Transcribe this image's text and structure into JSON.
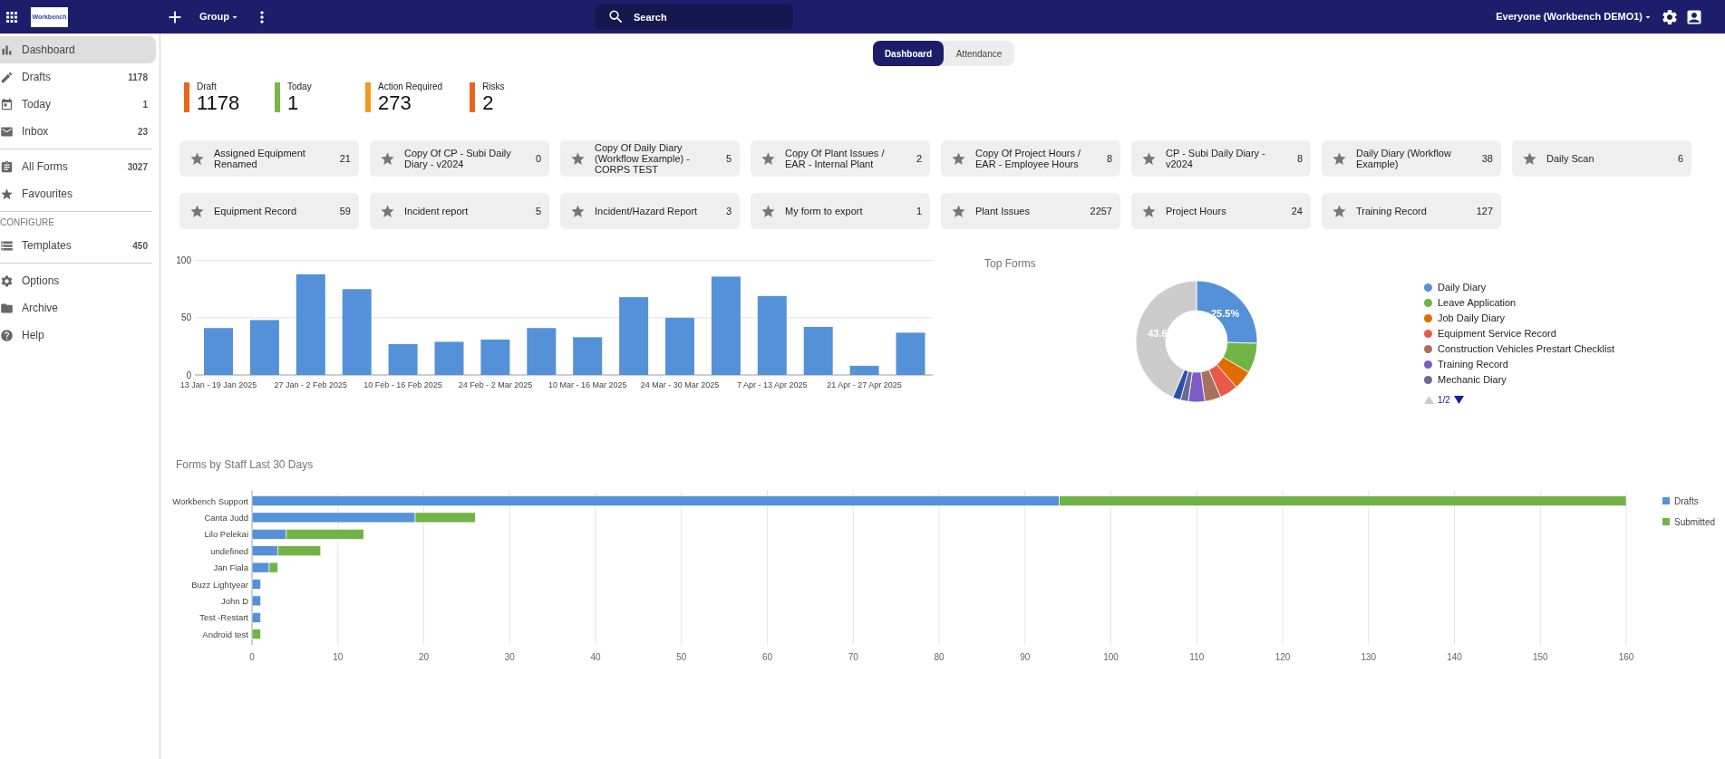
{
  "header": {
    "logo_text": "Workbench",
    "group_menu": "Group",
    "search": {
      "placeholder": "Search"
    },
    "account_menu": "Everyone (Workbench DEMO1)"
  },
  "sidebar": {
    "sections": [
      {
        "items": [
          {
            "label": "Dashboard",
            "selected": true
          },
          {
            "label": "Drafts",
            "count": "1178",
            "selected": false
          },
          {
            "label": "Today",
            "count": "1",
            "selected": false
          },
          {
            "label": "Inbox",
            "count": "23",
            "selected": false
          }
        ]
      },
      {
        "items": [
          {
            "label": "All Forms",
            "count": "3027",
            "selected": false
          },
          {
            "label": "Favourites",
            "selected": false
          }
        ]
      },
      {
        "heading": "CONFIGURE",
        "items": [
          {
            "label": "Templates",
            "count": "450",
            "selected": false
          }
        ]
      },
      {
        "items": [
          {
            "label": "Options",
            "selected": false
          },
          {
            "label": "Archive",
            "selected": false
          },
          {
            "label": "Help",
            "selected": false
          }
        ]
      }
    ]
  },
  "tabs": [
    {
      "label": "Dashboard",
      "selected": true
    },
    {
      "label": "Attendance",
      "selected": false
    }
  ],
  "stats": [
    {
      "label": "Draft",
      "value": "1178",
      "color": "#e8661a"
    },
    {
      "label": "Today",
      "value": "1",
      "color": "#7ab648"
    },
    {
      "label": "Action Required",
      "value": "273",
      "color": "#f29a1e"
    },
    {
      "label": "Risks",
      "value": "2",
      "color": "#e8661a"
    }
  ],
  "form_cards": [
    {
      "label": "Assigned Equipment Renamed",
      "count": "21"
    },
    {
      "label": "Copy Of CP - Subi Daily Diary - v2024",
      "count": "0"
    },
    {
      "label": "Copy Of Daily Diary (Workflow Example) - CORPS TEST",
      "count": "5"
    },
    {
      "label": "Copy Of Plant Issues / EAR - Internal Plant",
      "count": "2"
    },
    {
      "label": "Copy Of Project Hours / EAR - Employee Hours",
      "count": "8"
    },
    {
      "label": "CP - Subi Daily Diary - v2024",
      "count": "8"
    },
    {
      "label": "Daily Diary (Workflow Example)",
      "count": "38"
    },
    {
      "label": "Daily Scan",
      "count": "6"
    },
    {
      "label": "Equipment Record",
      "count": "59"
    },
    {
      "label": "Incident report",
      "count": "5"
    },
    {
      "label": "Incident/Hazard Report",
      "count": "3"
    },
    {
      "label": "My form to export",
      "count": "1"
    },
    {
      "label": "Plant Issues",
      "count": "2257"
    },
    {
      "label": "Project Hours",
      "count": "24"
    },
    {
      "label": "Training Record",
      "count": "127"
    }
  ],
  "weekly_chart": {
    "chart_data": {
      "type": "bar",
      "categories": [
        "13 Jan - 19 Jan 2025",
        null,
        "27 Jan - 2 Feb 2025",
        null,
        "10 Feb - 16 Feb 2025",
        null,
        "24 Feb - 2 Mar 2025",
        null,
        "10 Mar - 16 Mar 2025",
        null,
        "24 Mar - 30 Mar 2025",
        null,
        "7 Apr - 13 Apr 2025",
        null,
        "21 Apr - 27 Apr 2025",
        null
      ],
      "values": [
        41,
        48,
        88,
        75,
        27,
        29,
        31,
        41,
        33,
        68,
        50,
        86,
        69,
        42,
        8,
        37
      ],
      "yticks": [
        0,
        50,
        100
      ],
      "ylim": [
        0,
        100
      ],
      "grid": true
    }
  },
  "top_forms": {
    "chart_data": {
      "type": "donut",
      "title": "Top Forms",
      "categories": [
        "Daily Diary",
        "Leave Application",
        "Job Daily Diary",
        "Equipment Service Record",
        "Construction Vehicles Prestart Checklist",
        "Training Record",
        "Mechanic Diary",
        null,
        null
      ],
      "values": [
        25.5,
        8.0,
        5.1,
        4.9,
        4.3,
        4.4,
        2.1,
        2.1,
        43.6
      ],
      "colors": [
        "#5591d8",
        "#72b347",
        "#e06c00",
        "#e8594a",
        "#a8715e",
        "#7d5cc8",
        "#6a6c94",
        "#2a4ea6",
        "#cccccc"
      ],
      "value_labels": [
        "25.5%",
        null,
        null,
        null,
        null,
        null,
        null,
        null,
        "43.6"
      ],
      "legend": "right"
    },
    "pager": {
      "label": "1/2",
      "prev_enabled": false,
      "next_enabled": true
    }
  },
  "staff_chart": {
    "chart_data": {
      "type": "bar",
      "orientation": "horizontal",
      "stacked": true,
      "title": "Forms by Staff Last 30 Days",
      "categories": [
        "Workbench Support",
        "Canta Judd",
        "Lilo Pelekai",
        "undefined",
        "Jan Fiala",
        "Buzz Lightyear",
        "John D",
        "Test -Restart",
        "Android test"
      ],
      "series": [
        {
          "name": "Drafts",
          "color": "#5591d8",
          "values": [
            94,
            19,
            4,
            3,
            2,
            1,
            1,
            1,
            0
          ]
        },
        {
          "name": "Submitted",
          "color": "#72b347",
          "values": [
            66,
            7,
            9,
            5,
            1,
            0,
            0,
            0,
            1
          ]
        }
      ],
      "xticks": [
        0,
        10,
        20,
        30,
        40,
        50,
        60,
        70,
        80,
        90,
        100,
        110,
        120,
        130,
        140,
        150,
        160
      ],
      "xlim": [
        0,
        160
      ],
      "grid": true,
      "legend": "right"
    }
  }
}
